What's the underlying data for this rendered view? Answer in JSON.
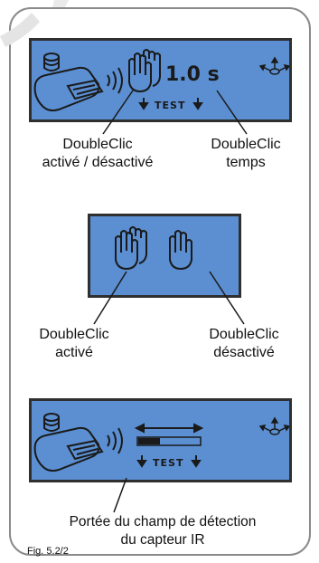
{
  "figure": {
    "caption": "Fig. 5.2/2"
  },
  "panel1": {
    "time_value": "1.0 s",
    "test_label": "TEST",
    "callouts": {
      "left_line1": "DoubleClic",
      "left_line2": "activé  / désactivé",
      "right_line1": "DoubleClic",
      "right_line2": "temps"
    }
  },
  "panel2": {
    "callouts": {
      "left_line1": "DoubleClic",
      "left_line2": "activé",
      "right_line1": "DoubleClic",
      "right_line2": "désactivé"
    }
  },
  "panel3": {
    "test_label": "TEST",
    "range_level": 0.35,
    "callouts": {
      "line1": "Portée du champ de détection",
      "line2": "du capteur IR"
    }
  },
  "icons": [
    "watermark-icon",
    "remote-control-icon",
    "ir-signal-icon",
    "double-hand-icon",
    "single-hand-icon",
    "move-arrows-icon",
    "down-arrow-icon",
    "double-arrow-icon",
    "range-bar-icon"
  ]
}
